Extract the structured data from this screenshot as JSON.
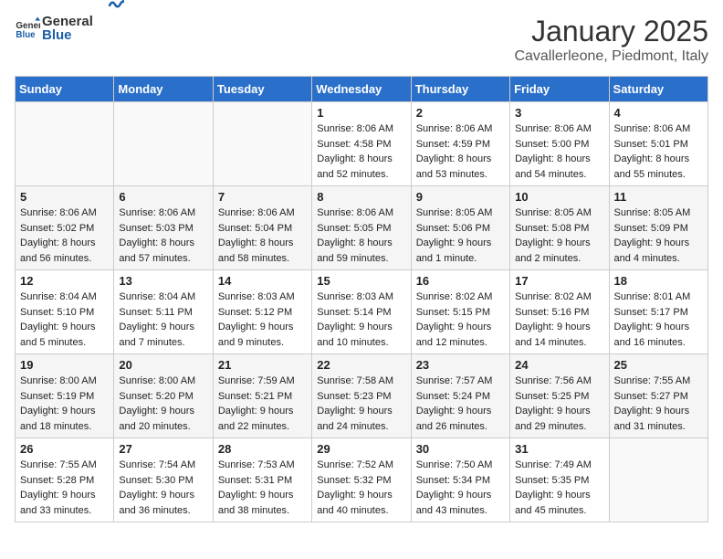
{
  "header": {
    "logo_text_general": "General",
    "logo_text_blue": "Blue",
    "month_title": "January 2025",
    "location": "Cavallerleone, Piedmont, Italy"
  },
  "days_of_week": [
    "Sunday",
    "Monday",
    "Tuesday",
    "Wednesday",
    "Thursday",
    "Friday",
    "Saturday"
  ],
  "weeks": [
    [
      {
        "day": "",
        "info": ""
      },
      {
        "day": "",
        "info": ""
      },
      {
        "day": "",
        "info": ""
      },
      {
        "day": "1",
        "info": "Sunrise: 8:06 AM\nSunset: 4:58 PM\nDaylight: 8 hours\nand 52 minutes."
      },
      {
        "day": "2",
        "info": "Sunrise: 8:06 AM\nSunset: 4:59 PM\nDaylight: 8 hours\nand 53 minutes."
      },
      {
        "day": "3",
        "info": "Sunrise: 8:06 AM\nSunset: 5:00 PM\nDaylight: 8 hours\nand 54 minutes."
      },
      {
        "day": "4",
        "info": "Sunrise: 8:06 AM\nSunset: 5:01 PM\nDaylight: 8 hours\nand 55 minutes."
      }
    ],
    [
      {
        "day": "5",
        "info": "Sunrise: 8:06 AM\nSunset: 5:02 PM\nDaylight: 8 hours\nand 56 minutes."
      },
      {
        "day": "6",
        "info": "Sunrise: 8:06 AM\nSunset: 5:03 PM\nDaylight: 8 hours\nand 57 minutes."
      },
      {
        "day": "7",
        "info": "Sunrise: 8:06 AM\nSunset: 5:04 PM\nDaylight: 8 hours\nand 58 minutes."
      },
      {
        "day": "8",
        "info": "Sunrise: 8:06 AM\nSunset: 5:05 PM\nDaylight: 8 hours\nand 59 minutes."
      },
      {
        "day": "9",
        "info": "Sunrise: 8:05 AM\nSunset: 5:06 PM\nDaylight: 9 hours\nand 1 minute."
      },
      {
        "day": "10",
        "info": "Sunrise: 8:05 AM\nSunset: 5:08 PM\nDaylight: 9 hours\nand 2 minutes."
      },
      {
        "day": "11",
        "info": "Sunrise: 8:05 AM\nSunset: 5:09 PM\nDaylight: 9 hours\nand 4 minutes."
      }
    ],
    [
      {
        "day": "12",
        "info": "Sunrise: 8:04 AM\nSunset: 5:10 PM\nDaylight: 9 hours\nand 5 minutes."
      },
      {
        "day": "13",
        "info": "Sunrise: 8:04 AM\nSunset: 5:11 PM\nDaylight: 9 hours\nand 7 minutes."
      },
      {
        "day": "14",
        "info": "Sunrise: 8:03 AM\nSunset: 5:12 PM\nDaylight: 9 hours\nand 9 minutes."
      },
      {
        "day": "15",
        "info": "Sunrise: 8:03 AM\nSunset: 5:14 PM\nDaylight: 9 hours\nand 10 minutes."
      },
      {
        "day": "16",
        "info": "Sunrise: 8:02 AM\nSunset: 5:15 PM\nDaylight: 9 hours\nand 12 minutes."
      },
      {
        "day": "17",
        "info": "Sunrise: 8:02 AM\nSunset: 5:16 PM\nDaylight: 9 hours\nand 14 minutes."
      },
      {
        "day": "18",
        "info": "Sunrise: 8:01 AM\nSunset: 5:17 PM\nDaylight: 9 hours\nand 16 minutes."
      }
    ],
    [
      {
        "day": "19",
        "info": "Sunrise: 8:00 AM\nSunset: 5:19 PM\nDaylight: 9 hours\nand 18 minutes."
      },
      {
        "day": "20",
        "info": "Sunrise: 8:00 AM\nSunset: 5:20 PM\nDaylight: 9 hours\nand 20 minutes."
      },
      {
        "day": "21",
        "info": "Sunrise: 7:59 AM\nSunset: 5:21 PM\nDaylight: 9 hours\nand 22 minutes."
      },
      {
        "day": "22",
        "info": "Sunrise: 7:58 AM\nSunset: 5:23 PM\nDaylight: 9 hours\nand 24 minutes."
      },
      {
        "day": "23",
        "info": "Sunrise: 7:57 AM\nSunset: 5:24 PM\nDaylight: 9 hours\nand 26 minutes."
      },
      {
        "day": "24",
        "info": "Sunrise: 7:56 AM\nSunset: 5:25 PM\nDaylight: 9 hours\nand 29 minutes."
      },
      {
        "day": "25",
        "info": "Sunrise: 7:55 AM\nSunset: 5:27 PM\nDaylight: 9 hours\nand 31 minutes."
      }
    ],
    [
      {
        "day": "26",
        "info": "Sunrise: 7:55 AM\nSunset: 5:28 PM\nDaylight: 9 hours\nand 33 minutes."
      },
      {
        "day": "27",
        "info": "Sunrise: 7:54 AM\nSunset: 5:30 PM\nDaylight: 9 hours\nand 36 minutes."
      },
      {
        "day": "28",
        "info": "Sunrise: 7:53 AM\nSunset: 5:31 PM\nDaylight: 9 hours\nand 38 minutes."
      },
      {
        "day": "29",
        "info": "Sunrise: 7:52 AM\nSunset: 5:32 PM\nDaylight: 9 hours\nand 40 minutes."
      },
      {
        "day": "30",
        "info": "Sunrise: 7:50 AM\nSunset: 5:34 PM\nDaylight: 9 hours\nand 43 minutes."
      },
      {
        "day": "31",
        "info": "Sunrise: 7:49 AM\nSunset: 5:35 PM\nDaylight: 9 hours\nand 45 minutes."
      },
      {
        "day": "",
        "info": ""
      }
    ]
  ]
}
